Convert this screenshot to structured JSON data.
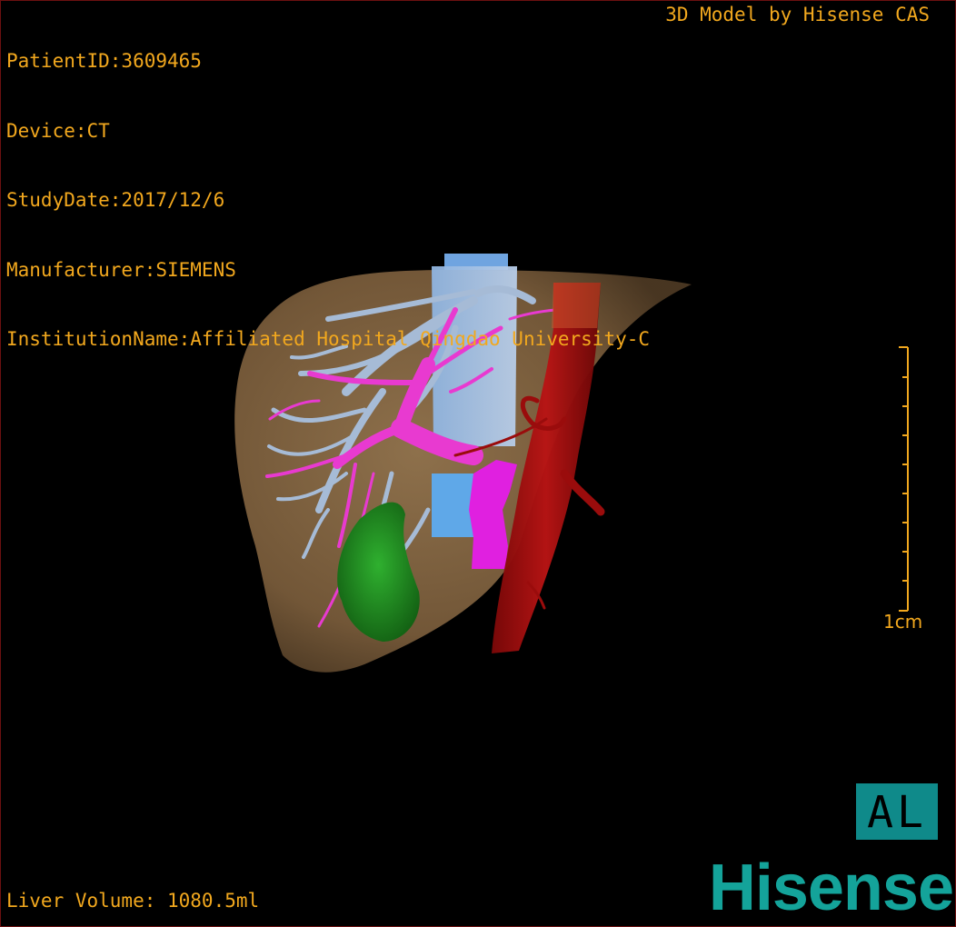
{
  "header": {
    "patient_id": "PatientID:3609465",
    "device": "Device:CT",
    "study_date": "StudyDate:2017/12/6",
    "manufacturer": "Manufacturer:SIEMENS",
    "institution": "InstitutionName:Affiliated Hospital Qingdao University-C"
  },
  "brand_caption": "3D Model by Hisense CAS",
  "scale_bar": {
    "label": "1cm"
  },
  "orientation": {
    "label": "AL"
  },
  "footer": {
    "liver_volume": "Liver Volume: 1080.5ml"
  },
  "logo": {
    "text": "Hisense"
  },
  "colors": {
    "overlay_text": "#f2a81e",
    "liver": "#8a6a45",
    "hepatic_vein": "#9fb4d0",
    "portal_vein": "#e83ad0",
    "ivc": "#5fa8e8",
    "artery": "#a00e0e",
    "tumor": "#1d8e1d",
    "pancreas_stump": "#e020e0",
    "logo": "#14a39a",
    "orientation_box": "#0f8a8a"
  }
}
